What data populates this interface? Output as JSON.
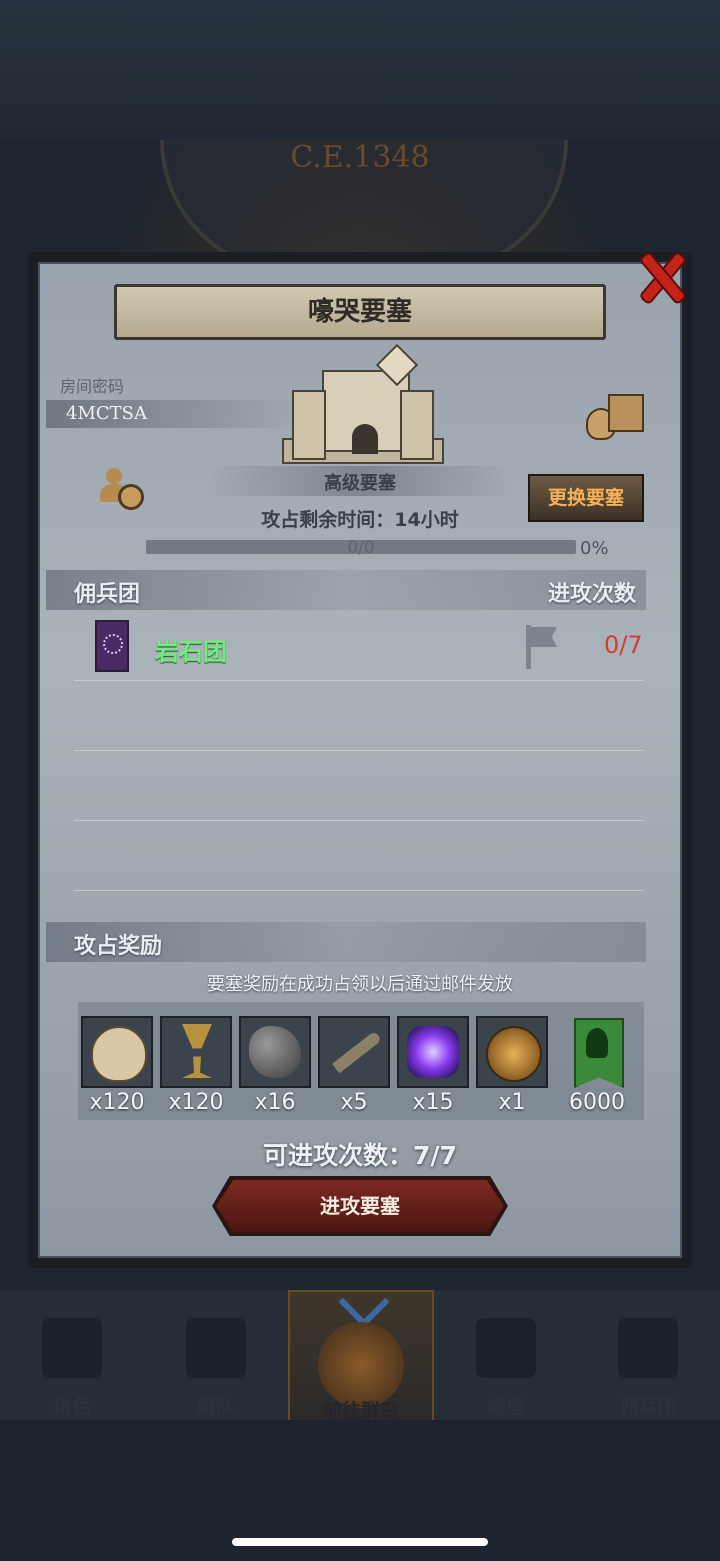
{
  "background": {
    "year_text": "C.E.1348"
  },
  "dialog": {
    "title": "嚎哭要塞",
    "room": {
      "label": "房间密码",
      "code": "4MCTSA"
    },
    "fortress_level": "高级要塞",
    "change_button": "更换要塞",
    "timer_text": "攻占剩余时间：14小时",
    "progress": {
      "count_text": "0/0",
      "percent_text": "0%",
      "fraction": 0
    },
    "mercenary_section": {
      "title": "佣兵团",
      "attacks_header": "进攻次数",
      "rows": [
        {
          "name": "岩石团",
          "attacks": "0/7"
        }
      ]
    },
    "rewards_section": {
      "title": "攻占奖励",
      "note": "要塞奖励在成功占领以后通过邮件发放",
      "items": [
        {
          "icon": "bag-icon",
          "qty": "x120"
        },
        {
          "icon": "goblet-icon",
          "qty": "x120"
        },
        {
          "icon": "ore-icon",
          "qty": "x16"
        },
        {
          "icon": "horn-icon",
          "qty": "x5"
        },
        {
          "icon": "crystal-icon",
          "qty": "x15"
        },
        {
          "icon": "medal-icon",
          "qty": "x1"
        },
        {
          "icon": "guild-banner-icon",
          "qty": "6000"
        }
      ]
    },
    "attacks_available": "可进攻次数：7/7",
    "attack_button": "进攻要塞"
  },
  "colors": {
    "accent_orange": "#f5b257",
    "merc_green": "#6ef078",
    "count_red": "#d43b33",
    "close_red": "#c5221a"
  },
  "bottom_nav": [
    {
      "label": "角色"
    },
    {
      "label": "编队"
    },
    {
      "label": "前往群岛",
      "active": true
    },
    {
      "label": "城堡"
    },
    {
      "label": "佣兵团"
    }
  ]
}
